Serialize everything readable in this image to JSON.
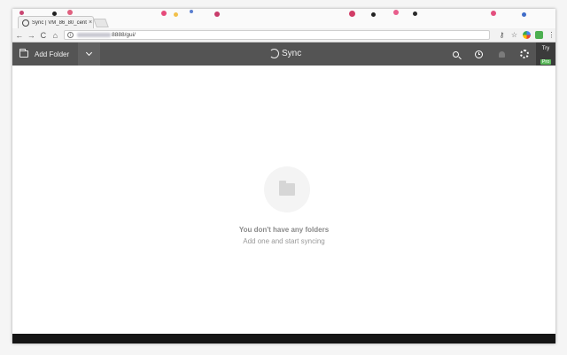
{
  "browser": {
    "tab_title": "Sync | VM_86_80_cent",
    "tab_close": "×",
    "url_visible": "8888/gui/",
    "nav": {
      "back": "←",
      "forward": "→",
      "reload": "C",
      "home": "⌂"
    },
    "info": "i",
    "bookmark_star": "☆",
    "key_icon": "⚷",
    "menu": "⋮"
  },
  "header": {
    "add_folder_label": "Add Folder",
    "brand_name": "Sync",
    "try_label": "Try",
    "pro_label": "Pro"
  },
  "empty_state": {
    "title": "You don't have any folders",
    "subtitle": "Add one and start syncing"
  },
  "colors": {
    "header_bg": "#545454",
    "pro_badge": "#5cb85c",
    "bottom_bar": "#151515"
  }
}
